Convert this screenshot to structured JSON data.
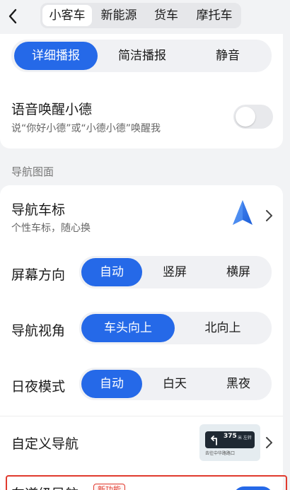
{
  "top_bar": {
    "tabs": [
      {
        "label": "小客车",
        "active": true
      },
      {
        "label": "新能源",
        "active": false
      },
      {
        "label": "货车",
        "active": false
      },
      {
        "label": "摩托车",
        "active": false
      }
    ]
  },
  "broadcast": {
    "options": [
      "详细播报",
      "简洁播报",
      "静音"
    ],
    "selected": "详细播报"
  },
  "voice_wake": {
    "title": "语音唤醒小德",
    "subtitle": "说“你好小德”或“小德小德”唤醒我",
    "enabled": false
  },
  "section_nav_map": "导航图面",
  "car_icon": {
    "title": "导航车标",
    "subtitle": "个性车标，随心换"
  },
  "screen_orientation": {
    "label": "屏幕方向",
    "options": [
      "自动",
      "竖屏",
      "横屏"
    ],
    "selected": "自动"
  },
  "nav_view": {
    "label": "导航视角",
    "options": [
      "车头向上",
      "北向上"
    ],
    "selected": "车头向上"
  },
  "day_night": {
    "label": "日夜模式",
    "options": [
      "自动",
      "白天",
      "黑夜"
    ],
    "selected": "自动"
  },
  "custom_nav": {
    "title": "自定义导航",
    "preview_number": "375",
    "preview_unit": "米 左转",
    "preview_sub": "去往中华路路口"
  },
  "lane_nav": {
    "title": "车道级导航",
    "badge": "新功能",
    "enabled": true
  },
  "colors": {
    "accent": "#2569e8",
    "highlight_border": "#e03a2e"
  }
}
